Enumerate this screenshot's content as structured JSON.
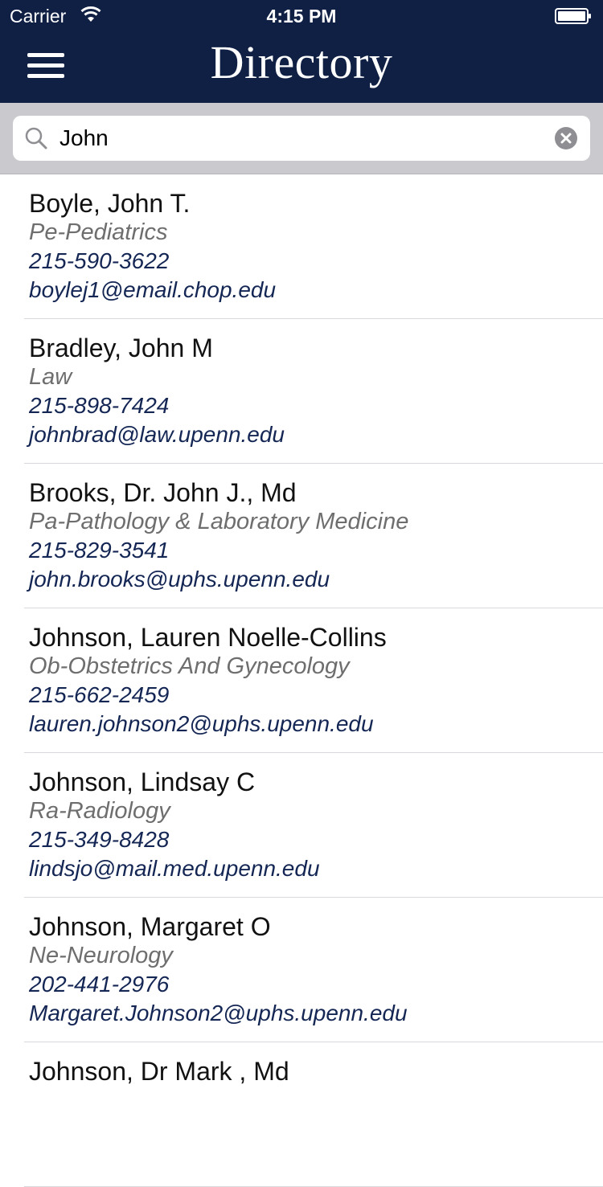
{
  "status_bar": {
    "carrier": "Carrier",
    "time": "4:15 PM",
    "wifi_icon": "wifi-icon",
    "battery_icon": "battery-icon"
  },
  "header": {
    "title": "Directory",
    "menu_icon": "hamburger-menu-icon",
    "background_color": "#0f2044"
  },
  "search": {
    "value": "John",
    "search_icon": "search-icon",
    "clear_icon": "clear-icon"
  },
  "colors": {
    "name": "#111111",
    "department": "#6e6e6e",
    "contact": "#142654"
  },
  "results": [
    {
      "name": "Boyle, John T.",
      "department": "Pe-Pediatrics",
      "phone": "215-590-3622",
      "email": "boylej1@email.chop.edu"
    },
    {
      "name": "Bradley, John M",
      "department": "Law",
      "phone": "215-898-7424",
      "email": "johnbrad@law.upenn.edu"
    },
    {
      "name": "Brooks, Dr. John J., Md",
      "department": "Pa-Pathology & Laboratory Medicine",
      "phone": "215-829-3541",
      "email": "john.brooks@uphs.upenn.edu"
    },
    {
      "name": "Johnson, Lauren Noelle-Collins",
      "department": "Ob-Obstetrics And Gynecology",
      "phone": "215-662-2459",
      "email": "lauren.johnson2@uphs.upenn.edu"
    },
    {
      "name": "Johnson, Lindsay C",
      "department": "Ra-Radiology",
      "phone": "215-349-8428",
      "email": "lindsjo@mail.med.upenn.edu"
    },
    {
      "name": "Johnson, Margaret O",
      "department": "Ne-Neurology",
      "phone": "202-441-2976",
      "email": "Margaret.Johnson2@uphs.upenn.edu"
    },
    {
      "name": "Johnson, Dr Mark , Md",
      "department": "",
      "phone": "",
      "email": ""
    }
  ]
}
